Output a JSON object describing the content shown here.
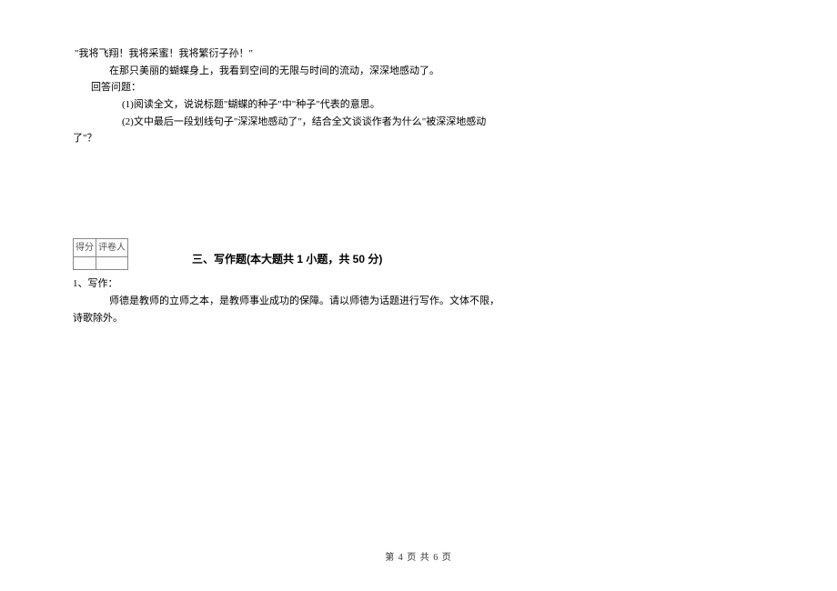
{
  "passage": {
    "quote": "\"我将飞翔！我将采蜜！我将繁衍子孙！\"",
    "line1": "在那只美丽的蝴蝶身上，我看到空间的无限与时间的流动，深深地感动了。",
    "answer_label": "回答问题：",
    "q1": "(1)阅读全文，说说标题\"蝴蝶的种子\"中\"种子\"代表的意思。",
    "q2_a": "(2)文中最后一段划线句子\"深深地感动了\"，结合全文谈谈作者为什么\"被深深地感动",
    "q2_b": "了\"？"
  },
  "score_box": {
    "score_label": "得分",
    "reviewer_label": "评卷人"
  },
  "section3": {
    "title": "三、写作题(本大题共 1 小题，共 50 分)",
    "q_num": "1、写作：",
    "prompt": "师德是教师的立师之本，是教师事业成功的保障。请以师德为话题进行写作。文体不限，",
    "prompt_tail": "诗歌除外。"
  },
  "footer": "第 4 页 共 6 页"
}
